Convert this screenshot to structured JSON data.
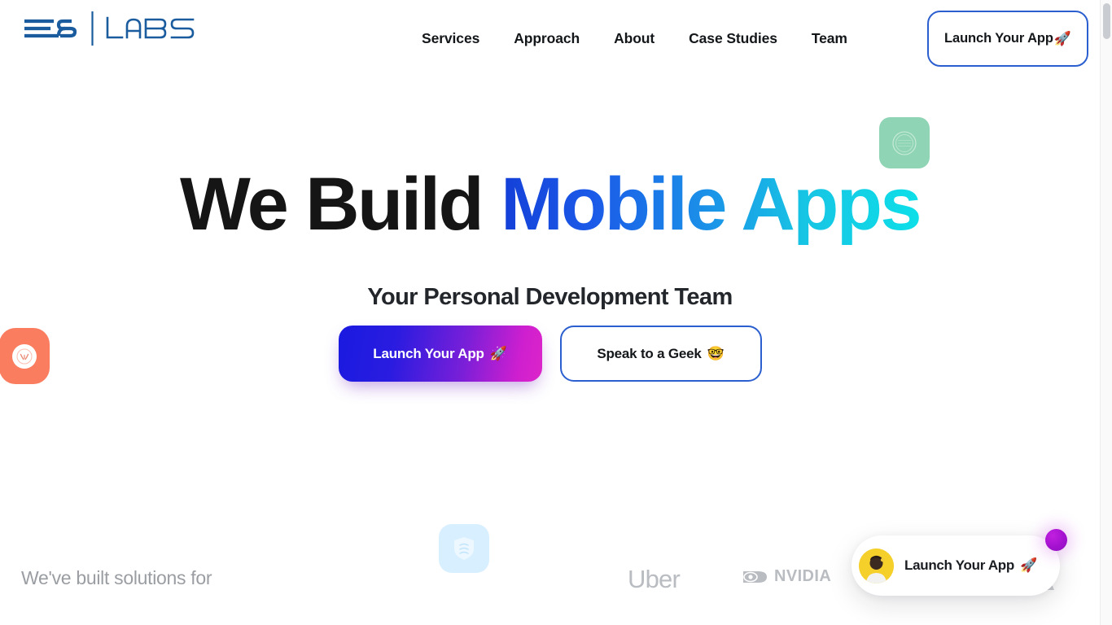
{
  "brand": {
    "mark": "e8-logo",
    "mark_label": "E8",
    "word_label": "LABS",
    "color": "#1b5c9e"
  },
  "nav": {
    "items": [
      {
        "label": "Services"
      },
      {
        "label": "Approach"
      },
      {
        "label": "About"
      },
      {
        "label": "Case Studies"
      },
      {
        "label": "Team"
      }
    ],
    "cta_label": "Launch Your App",
    "cta_emoji": "🚀",
    "cta_border_color": "#2b5fd0"
  },
  "hero": {
    "title_plain": "We Build ",
    "title_gradient": "Mobile Apps",
    "title_plain_color": "#151515",
    "gradient_from": "#1440d8",
    "gradient_to": "#0ddfe8",
    "subtitle": "Your Personal Development Team",
    "primary_label": "Launch Your App",
    "primary_emoji": "🚀",
    "primary_gradient_from": "#1a1ae0",
    "primary_gradient_to": "#dc25c9",
    "secondary_label": "Speak to a Geek",
    "secondary_emoji": "🤓",
    "secondary_border_color": "#2b5fd0"
  },
  "decor": {
    "green_icon": "app-badge-icon",
    "green_color": "#8fd4b4",
    "orange_icon": "owl-app-icon",
    "orange_color": "#fb7d5f",
    "blue_icon": "shield-app-icon",
    "blue_color": "#d8efff"
  },
  "clients": {
    "label": "We've built solutions for",
    "label_color": "#9a9da2",
    "logos": [
      {
        "name": "Uber",
        "text": "Uber"
      },
      {
        "name": "NVIDIA",
        "text": "NVIDIA"
      }
    ],
    "logo_color": "#b9bcc1"
  },
  "chat_widget": {
    "avatar": "person-avatar",
    "message": "Launch Your App",
    "emoji": "🚀",
    "dot_color": "#a312cf"
  },
  "scrollbar": {
    "name": "page-scrollbar",
    "thumb_color": "#c9ccd0"
  }
}
